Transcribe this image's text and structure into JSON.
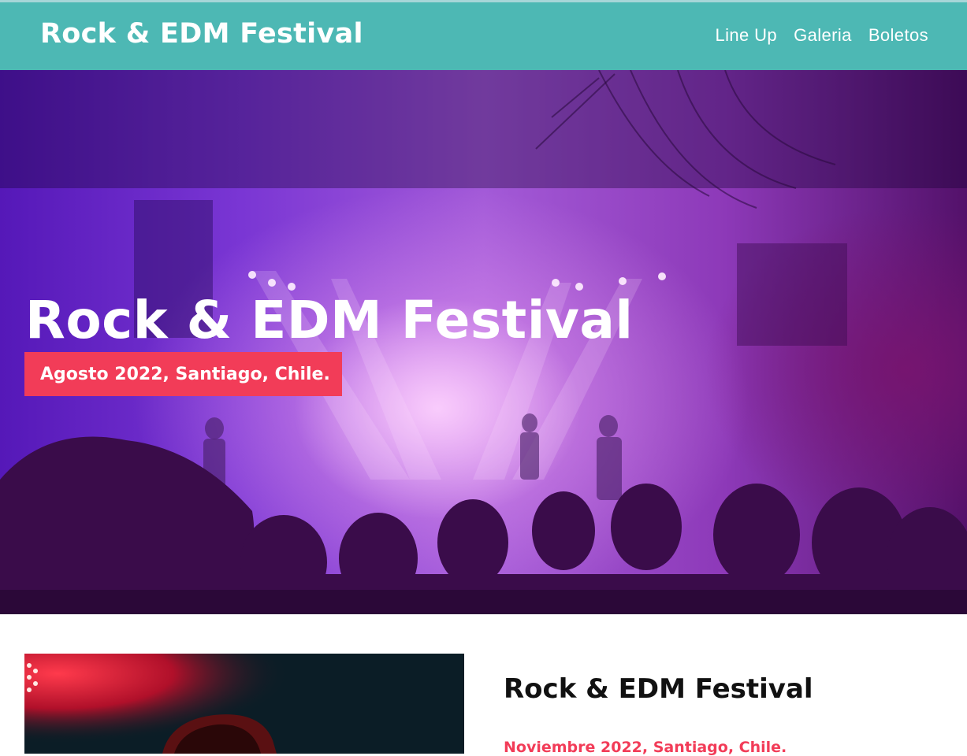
{
  "header": {
    "logo": "Rock & EDM Festival",
    "nav": [
      {
        "label": "Line Up"
      },
      {
        "label": "Galeria"
      },
      {
        "label": "Boletos"
      }
    ]
  },
  "hero": {
    "title": "Rock & EDM Festival",
    "badge": "Agosto 2022, Santiago, Chile."
  },
  "section": {
    "title": "Rock & EDM Festival",
    "subtitle": "Noviembre 2022, Santiago, Chile."
  },
  "colors": {
    "header_bg": "#4db8b4",
    "accent": "#f23c58",
    "text_dark": "#111111"
  }
}
